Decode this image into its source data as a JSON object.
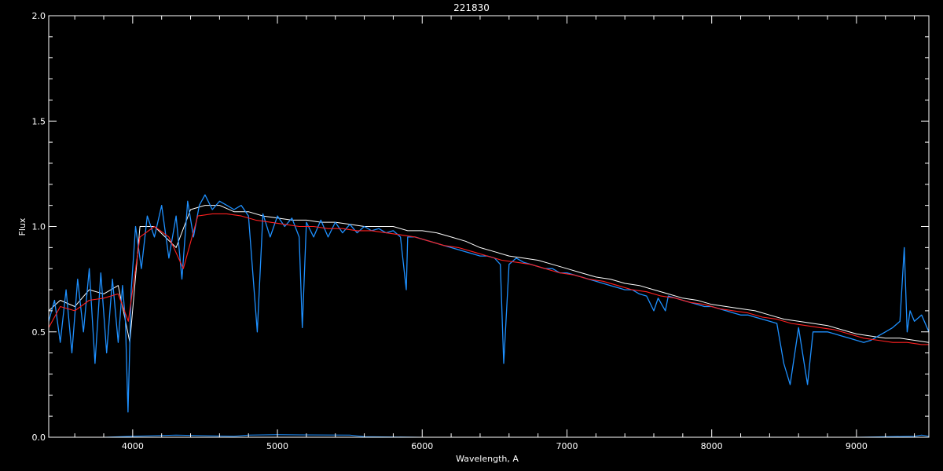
{
  "chart_data": {
    "type": "line",
    "title": "221830",
    "xlabel": "Wavelength, A",
    "ylabel": "Flux",
    "xlim": [
      3420,
      9500
    ],
    "ylim": [
      0.0,
      2.0
    ],
    "x_ticks": [
      4000,
      5000,
      6000,
      7000,
      8000,
      9000
    ],
    "x_tick_labels": [
      "4000",
      "5000",
      "6000",
      "7000",
      "8000",
      "9000"
    ],
    "y_ticks": [
      0.0,
      0.5,
      1.0,
      1.5,
      2.0
    ],
    "y_tick_labels": [
      "0.0",
      "0.5",
      "1.0",
      "1.5",
      "2.0"
    ],
    "grid": false,
    "legend": "none",
    "colors": {
      "background": "#000000",
      "axes": "#ffffff",
      "model": "#ffffff",
      "observed": "#1e90ff",
      "reference": "#ff2020",
      "error": "#1e90ff"
    },
    "series": [
      {
        "color": "#ffffff",
        "x": [
          3420,
          3500,
          3600,
          3700,
          3800,
          3900,
          3980,
          4050,
          4150,
          4300,
          4400,
          4500,
          4600,
          4700,
          4800,
          4900,
          5000,
          5100,
          5200,
          5300,
          5400,
          5500,
          5600,
          5700,
          5800,
          5900,
          6000,
          6100,
          6200,
          6300,
          6400,
          6500,
          6600,
          6700,
          6800,
          6900,
          7000,
          7100,
          7200,
          7300,
          7400,
          7500,
          7600,
          7700,
          7800,
          7900,
          8000,
          8100,
          8200,
          8300,
          8400,
          8500,
          8600,
          8700,
          8800,
          8900,
          9000,
          9100,
          9200,
          9300,
          9400,
          9500
        ],
        "values": [
          0.6,
          0.65,
          0.62,
          0.7,
          0.68,
          0.72,
          0.45,
          1.0,
          1.0,
          0.9,
          1.08,
          1.1,
          1.1,
          1.07,
          1.07,
          1.05,
          1.04,
          1.03,
          1.03,
          1.02,
          1.02,
          1.01,
          1.0,
          1.0,
          1.0,
          0.98,
          0.98,
          0.97,
          0.95,
          0.93,
          0.9,
          0.88,
          0.86,
          0.85,
          0.84,
          0.82,
          0.8,
          0.78,
          0.76,
          0.75,
          0.73,
          0.72,
          0.7,
          0.68,
          0.66,
          0.65,
          0.63,
          0.62,
          0.61,
          0.6,
          0.58,
          0.56,
          0.55,
          0.54,
          0.53,
          0.51,
          0.49,
          0.48,
          0.47,
          0.47,
          0.46,
          0.45
        ]
      },
      {
        "color": "#1e90ff",
        "x": [
          3420,
          3460,
          3500,
          3540,
          3580,
          3620,
          3660,
          3700,
          3740,
          3780,
          3820,
          3860,
          3900,
          3930,
          3950,
          3968,
          3990,
          4020,
          4060,
          4101,
          4150,
          4200,
          4250,
          4300,
          4340,
          4380,
          4420,
          4460,
          4500,
          4550,
          4600,
          4650,
          4700,
          4750,
          4800,
          4861,
          4900,
          4950,
          5000,
          5050,
          5100,
          5150,
          5172,
          5200,
          5250,
          5300,
          5350,
          5400,
          5450,
          5500,
          5550,
          5600,
          5650,
          5700,
          5750,
          5800,
          5850,
          5890,
          5900,
          5950,
          6000,
          6050,
          6100,
          6150,
          6200,
          6250,
          6300,
          6350,
          6400,
          6450,
          6500,
          6540,
          6563,
          6600,
          6650,
          6700,
          6750,
          6800,
          6850,
          6900,
          6950,
          7000,
          7050,
          7100,
          7150,
          7200,
          7250,
          7300,
          7350,
          7400,
          7450,
          7500,
          7550,
          7600,
          7630,
          7680,
          7700,
          7750,
          7800,
          7850,
          7900,
          7950,
          8000,
          8050,
          8100,
          8150,
          8200,
          8250,
          8300,
          8350,
          8400,
          8450,
          8498,
          8542,
          8600,
          8662,
          8700,
          8750,
          8800,
          8850,
          8900,
          8950,
          9000,
          9050,
          9100,
          9150,
          9200,
          9250,
          9300,
          9330,
          9350,
          9370,
          9400,
          9450,
          9500
        ],
        "values": [
          0.55,
          0.65,
          0.45,
          0.7,
          0.4,
          0.75,
          0.5,
          0.8,
          0.35,
          0.78,
          0.4,
          0.75,
          0.45,
          0.72,
          0.55,
          0.12,
          0.7,
          1.0,
          0.8,
          1.05,
          0.95,
          1.1,
          0.85,
          1.05,
          0.75,
          1.12,
          0.95,
          1.1,
          1.15,
          1.08,
          1.12,
          1.1,
          1.08,
          1.1,
          1.05,
          0.5,
          1.06,
          0.95,
          1.05,
          1.0,
          1.04,
          0.95,
          0.52,
          1.02,
          0.95,
          1.03,
          0.95,
          1.02,
          0.97,
          1.01,
          0.97,
          1.0,
          0.98,
          0.99,
          0.97,
          0.98,
          0.95,
          0.7,
          0.95,
          0.95,
          0.94,
          0.93,
          0.92,
          0.91,
          0.9,
          0.89,
          0.88,
          0.87,
          0.86,
          0.86,
          0.85,
          0.82,
          0.35,
          0.82,
          0.85,
          0.83,
          0.82,
          0.81,
          0.8,
          0.8,
          0.78,
          0.78,
          0.77,
          0.76,
          0.75,
          0.74,
          0.73,
          0.72,
          0.71,
          0.7,
          0.7,
          0.68,
          0.67,
          0.6,
          0.66,
          0.6,
          0.67,
          0.66,
          0.65,
          0.64,
          0.63,
          0.62,
          0.62,
          0.61,
          0.6,
          0.59,
          0.58,
          0.58,
          0.57,
          0.56,
          0.55,
          0.54,
          0.35,
          0.25,
          0.52,
          0.25,
          0.5,
          0.5,
          0.5,
          0.49,
          0.48,
          0.47,
          0.46,
          0.45,
          0.46,
          0.48,
          0.5,
          0.52,
          0.55,
          0.9,
          0.5,
          0.6,
          0.55,
          0.58,
          0.5
        ]
      },
      {
        "color": "#ff2020",
        "x": [
          3420,
          3500,
          3600,
          3700,
          3800,
          3900,
          3970,
          4050,
          4150,
          4250,
          4350,
          4450,
          4550,
          4650,
          4750,
          4850,
          4950,
          5050,
          5150,
          5250,
          5350,
          5450,
          5550,
          5650,
          5750,
          5850,
          5950,
          6050,
          6150,
          6250,
          6350,
          6450,
          6550,
          6650,
          6750,
          6850,
          6950,
          7050,
          7150,
          7250,
          7350,
          7450,
          7550,
          7650,
          7750,
          7850,
          7950,
          8050,
          8150,
          8250,
          8350,
          8450,
          8550,
          8650,
          8750,
          8850,
          8950,
          9050,
          9150,
          9250,
          9350,
          9450,
          9500
        ],
        "values": [
          0.52,
          0.62,
          0.6,
          0.65,
          0.66,
          0.68,
          0.55,
          0.95,
          1.0,
          0.95,
          0.8,
          1.05,
          1.06,
          1.06,
          1.05,
          1.03,
          1.02,
          1.01,
          1.0,
          1.0,
          0.99,
          0.99,
          0.98,
          0.98,
          0.97,
          0.96,
          0.95,
          0.93,
          0.91,
          0.9,
          0.88,
          0.86,
          0.84,
          0.83,
          0.82,
          0.8,
          0.78,
          0.77,
          0.75,
          0.74,
          0.72,
          0.7,
          0.69,
          0.67,
          0.66,
          0.64,
          0.63,
          0.61,
          0.6,
          0.59,
          0.57,
          0.56,
          0.54,
          0.53,
          0.52,
          0.51,
          0.49,
          0.47,
          0.46,
          0.45,
          0.45,
          0.44,
          0.44
        ]
      },
      {
        "color": "#1e90ff",
        "x": [
          3420,
          3800,
          4000,
          4300,
          4700,
          4800,
          5000,
          5500,
          5600,
          6000,
          7000,
          8000,
          9000,
          9400,
          9450,
          9500
        ],
        "values": [
          0.0,
          0.0,
          0.005,
          0.01,
          0.005,
          0.01,
          0.012,
          0.01,
          0.003,
          0.0,
          0.0,
          0.0,
          0.0,
          0.005,
          0.01,
          0.005
        ]
      }
    ]
  }
}
